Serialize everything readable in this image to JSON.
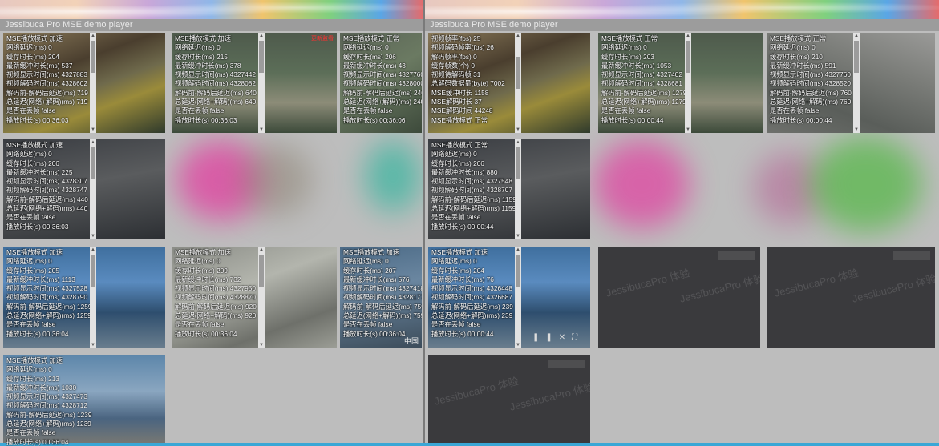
{
  "left_window": {
    "title": "Jessibuca Pro MSE demo player",
    "panels": [
      {
        "stats": [
          "MSE播放模式 加速",
          "网络延迟(ms) 0",
          "缓存时长(ms) 204",
          "最新缓冲时长(ms) 537",
          "视频显示时间(ms) 4327883",
          "视频解码时间(ms) 4328602",
          "解码前-解码后延迟(ms) 719",
          "总延迟(网络+解码)(ms) 719",
          "是否在丢帧 false",
          "播放时长(s) 00:36:03"
        ]
      },
      {
        "stats": [
          "MSE播放模式 加速",
          "网络延迟(ms) 0",
          "缓存时长(ms) 215",
          "最新缓冲时长(ms) 378",
          "视频显示时间(ms) 4327442",
          "视频解码时间(ms) 4328082",
          "解码前-解码后延迟(ms) 640",
          "总延迟(网络+解码)(ms) 640",
          "是否在丢帧 false",
          "播放时长(s) 00:36:03"
        ],
        "red_label": "更新监看"
      },
      {
        "stats": [
          "MSE播放模式 正常",
          "网络延迟(ms) 0",
          "缓存时长(ms) 206",
          "最新缓冲时长(ms) 43",
          "视频显示时间(ms) 4327760",
          "视频解码时间(ms) 4328000",
          "解码前-解码后延迟(ms) 240",
          "总延迟(网络+解码)(ms) 240",
          "是否在丢帧 false",
          "播放时长(s) 00:36:06"
        ]
      },
      {
        "stats": [
          "MSE播放模式 加速",
          "网络延迟(ms) 0",
          "缓存时长(ms) 206",
          "最新缓冲时长(ms) 225",
          "视频显示时间(ms) 4328307",
          "视频解码时间(ms) 4328747",
          "解码前-解码后延迟(ms) 440",
          "总延迟(网络+解码)(ms) 440",
          "是否在丢帧 false",
          "播放时长(s) 00:36:03"
        ]
      },
      {
        "stats": [
          "MSE播放模式 加速",
          "网络延迟(ms) 0",
          "缓存时长(ms) 205",
          "最新缓冲时长(ms) 1113",
          "视频显示时间(ms) 4327528",
          "视频解码时间(ms) 4328790",
          "解码前-解码后延迟(ms) 1259",
          "总延迟(网络+解码)(ms) 1259",
          "是否在丢帧 false",
          "播放时长(s) 00:36:04"
        ]
      },
      {
        "stats": [
          "MSE播放模式 加速",
          "网络延迟(ms) 0",
          "缓存时长(ms) 209",
          "最新缓冲时长(ms) 732",
          "视频显示时间(ms) 4327950",
          "视频解码时间(ms) 4328870",
          "解码前-解码后延迟(ms) 920",
          "总延迟(网络+解码)(ms) 920",
          "是否在丢帧 false",
          "播放时长(s) 00:36:04"
        ]
      },
      {
        "stats": [
          "MSE播放模式 加速",
          "网络延迟(ms) 0",
          "缓存时长(ms) 207",
          "最新缓冲时长(ms) 576",
          "视频显示时间(ms) 4327418",
          "视频解码时间(ms) 4328177",
          "解码前-解码后延迟(ms) 759",
          "总延迟(网络+解码)(ms) 759",
          "是否在丢帧 false",
          "播放时长(s) 00:36:04"
        ],
        "corner_text": "中国"
      },
      {
        "stats": [
          "MSE播放模式 加速",
          "网络延迟(ms) 0",
          "缓存时长(ms) 213",
          "最新缓冲时长(ms) 1030",
          "视频显示时间(ms) 4327473",
          "视频解码时间(ms) 4328712",
          "解码前-解码后延迟(ms) 1239",
          "总延迟(网络+解码)(ms) 1239",
          "是否在丢帧 false",
          "播放时长(s) 00:36:04"
        ]
      }
    ]
  },
  "right_window": {
    "title": "Jessibuca Pro MSE demo player",
    "panels": [
      {
        "stats": [
          "视频帧率(fps) 25",
          "视频解码帧率(fps) 26",
          "解码帧率(fps) 0",
          "缓存帧数(个) 0",
          "视频待解码帧 31",
          "总解码数据量(byte) 7002",
          "MSE缓冲时长 1158",
          "MSE解码时长 37",
          "MSE解码时间 44248",
          "MSE播放模式 正常"
        ]
      },
      {
        "stats": [
          "MSE播放模式 正常",
          "网络延迟(ms) 0",
          "缓存时长(ms) 203",
          "最新缓冲时长(ms) 1053",
          "视频显示时间(ms) 4327402",
          "视频解码时间(ms) 4328681",
          "解码前-解码后延迟(ms) 1279",
          "总延迟(网络+解码)(ms) 1279",
          "是否在丢帧 false",
          "播放时长(s) 00:00:44"
        ]
      },
      {
        "stats": [
          "MSE播放模式 正常",
          "网络延迟(ms) 0",
          "缓存时长(ms) 210",
          "最新缓冲时长(ms) 591",
          "视频显示时间(ms) 4327760",
          "视频解码时间(ms) 4328520",
          "解码前-解码后延迟(ms) 760",
          "总延迟(网络+解码)(ms) 760",
          "是否在丢帧 false",
          "播放时长(s) 00:00:44"
        ]
      },
      {
        "stats": [
          "MSE播放模式 正常",
          "网络延迟(ms) 0",
          "缓存时长(ms) 206",
          "最新缓冲时长(ms) 880",
          "视频显示时间(ms) 4327548",
          "视频解码时间(ms) 4328707",
          "解码前-解码后延迟(ms) 1159",
          "总延迟(网络+解码)(ms) 1159",
          "是否在丢帧 false",
          "播放时长(s) 00:00:44"
        ]
      },
      {
        "stats": [
          "MSE播放模式 加速",
          "网络延迟(ms) 0",
          "缓存时长(ms) 204",
          "最新缓冲时长(ms) 76",
          "视频显示时间(ms) 4326448",
          "视频解码时间(ms) 4326687",
          "解码前-解码后延迟(ms) 239",
          "总延迟(网络+解码)(ms) 239",
          "是否在丢帧 false",
          "播放时长(s) 00:00:44"
        ]
      }
    ],
    "watermark": "JessibucaPro 体验"
  }
}
